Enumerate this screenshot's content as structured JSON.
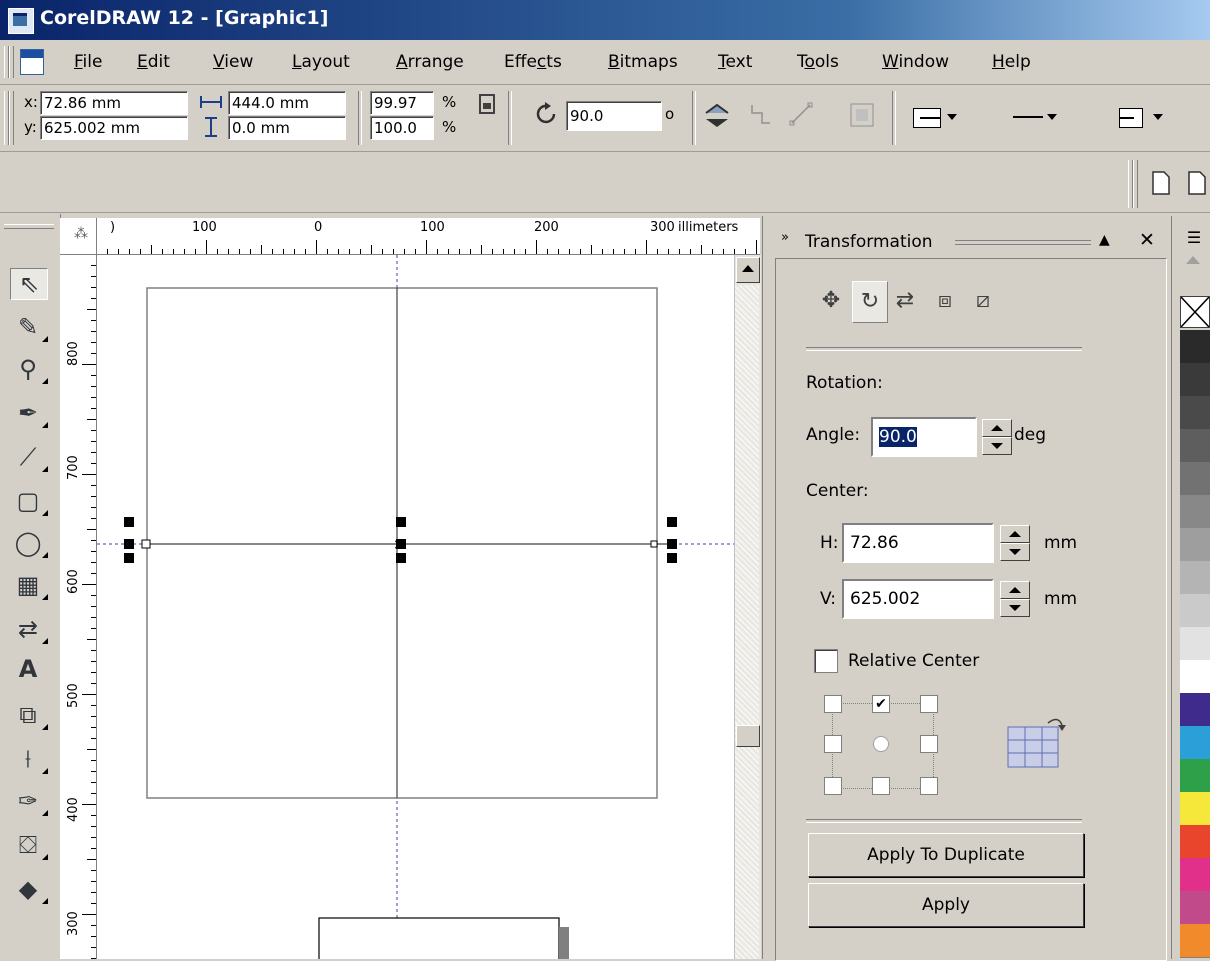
{
  "window": {
    "title": "CorelDRAW 12 - [Graphic1]"
  },
  "menu": [
    {
      "label": "File",
      "hot": "F",
      "rest": "ile"
    },
    {
      "label": "Edit",
      "hot": "E",
      "rest": "dit"
    },
    {
      "label": "View",
      "hot": "V",
      "rest": "iew"
    },
    {
      "label": "Layout",
      "hot": "L",
      "rest": "ayout"
    },
    {
      "label": "Arrange",
      "hot": "A",
      "rest": "rrange"
    },
    {
      "label": "Effects",
      "pre": "Effe",
      "hot": "c",
      "rest": "ts"
    },
    {
      "label": "Bitmaps",
      "hot": "B",
      "rest": "itmaps"
    },
    {
      "label": "Text",
      "hot": "T",
      "rest": "ext"
    },
    {
      "label": "Tools",
      "pre": "T",
      "hot": "o",
      "rest": "ols"
    },
    {
      "label": "Window",
      "hot": "W",
      "rest": "indow"
    },
    {
      "label": "Help",
      "hot": "H",
      "rest": "elp"
    }
  ],
  "propbar": {
    "x_label": "x:",
    "x_value": "72.86 mm",
    "y_label": "y:",
    "y_value": "625.002 mm",
    "width_value": "444.0 mm",
    "height_value": "0.0 mm",
    "scale_x": "99.97",
    "scale_y": "100.0",
    "percent": "%",
    "angle_value": "90.0",
    "degree": "o"
  },
  "ruler": {
    "h_labels": [
      "100",
      "0",
      "100",
      "200",
      "300"
    ],
    "h_partial_left": ")",
    "h_units": "illimeters",
    "v_labels": [
      "800",
      "700",
      "600",
      "500",
      "400",
      "300"
    ]
  },
  "docker": {
    "title": "Transformation",
    "section_rotation": "Rotation:",
    "angle_label": "Angle:",
    "angle_value": "90.0",
    "angle_unit": "deg",
    "section_center": "Center:",
    "h_label": "H:",
    "h_value": "72.86",
    "h_unit": "mm",
    "v_label": "V:",
    "v_value": "625.002",
    "v_unit": "mm",
    "relative_center_label": "Relative Center",
    "relative_center_checked": false,
    "apply_duplicate_label": "Apply To Duplicate",
    "apply_label": "Apply",
    "tabs": [
      "position-icon",
      "rotate-icon",
      "scale-mirror-icon",
      "size-icon",
      "skew-icon"
    ],
    "active_tab": "rotate-icon"
  },
  "icons": {
    "check": "✔",
    "close": "✕",
    "collapse": "▲",
    "expand": "»"
  },
  "palette": {
    "colors": [
      "#2a2a2a",
      "#3a3a3a",
      "#4a4a4a",
      "#5e5e5e",
      "#727272",
      "#888888",
      "#9e9e9e",
      "#b4b4b4",
      "#cacaca",
      "#e2e2e2",
      "#ffffff",
      "#3e2b8c",
      "#2a9fd8",
      "#2fa04a",
      "#f6e83a",
      "#e8452c",
      "#e0308a",
      "#c04a8a",
      "#f08a2a"
    ]
  }
}
